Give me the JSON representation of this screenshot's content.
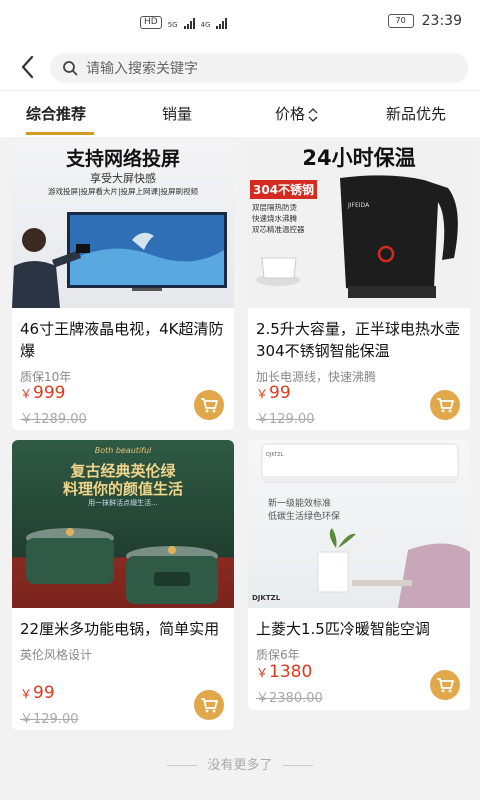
{
  "status": {
    "time": "23:39",
    "battery": "70",
    "hd_badge": "HD",
    "sim1": "5G",
    "sim2": "4G"
  },
  "search": {
    "placeholder": "请输入搜索关键字"
  },
  "sort_tabs": [
    {
      "label": "综合推荐",
      "active": true
    },
    {
      "label": "销量"
    },
    {
      "label": "价格"
    },
    {
      "label": "新品优先"
    }
  ],
  "products": [
    {
      "image_headline": "支持网络投屏",
      "image_sub": "享受大屏快感",
      "image_caption": "游戏投屏|投屏看大片|投屏上网课|投屏刷视频",
      "title": "46寸王牌液晶电视，4K超清防爆",
      "subtitle": "质保10年",
      "currency": "￥",
      "price": "999",
      "original_price": "￥1289.00"
    },
    {
      "image_headline": "24小时保温",
      "image_tag": "304不锈钢",
      "image_features": [
        "双层隔热防烫",
        "快速烧水沸腾",
        "双芯精准温控器"
      ],
      "image_brand": "JIFEIDA",
      "title": "2.5升大容量，正半球电热水壶304不锈钢智能保温",
      "subtitle": "加长电源线，快速沸腾",
      "currency": "￥",
      "price": "99",
      "original_price": "￥129.00"
    },
    {
      "image_script": "Both beautiful",
      "image_headline1": "复古经典英伦绿",
      "image_headline2": "料理你的颜值生活",
      "image_caption": "用一抹鲜活点缀生活...",
      "title": "22厘米多功能电锅，简单实用",
      "subtitle": "英伦风格设计",
      "currency": "￥",
      "price": "99",
      "original_price": "￥129.00"
    },
    {
      "image_brand": "DJKTZL",
      "image_line1": "新一级能效标准",
      "image_line2": "低碳生活绿色环保",
      "title": "上菱大1.5匹冷暖智能空调",
      "subtitle": "质保6年",
      "currency": "￥",
      "price": "1380",
      "original_price": "￥2380.00"
    }
  ],
  "footer": "没有更多了",
  "colors": {
    "accent": "#d49a2a",
    "price": "#e0391d",
    "cart": "#e0a84a"
  }
}
